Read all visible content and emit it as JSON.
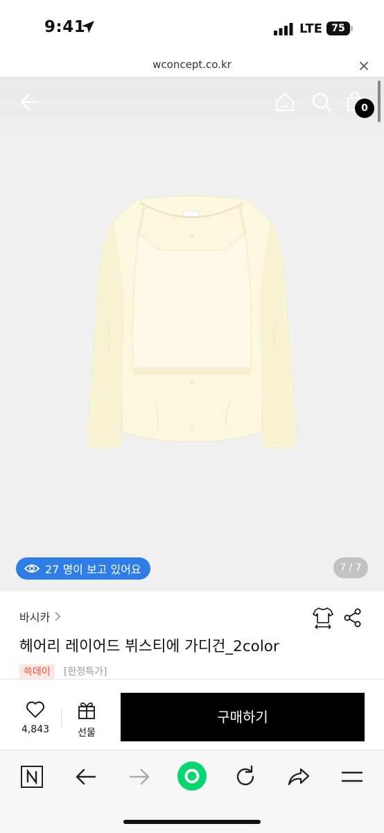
{
  "status_bar": {
    "time": "9:41",
    "network": "LTE",
    "battery": "75"
  },
  "browser": {
    "url": "wconcept.co.kr"
  },
  "hero": {
    "cart_count": "0",
    "viewers_text": "27 명이 보고 있어요",
    "page_indicator": "7 / 7"
  },
  "product": {
    "brand": "바시카",
    "title": "헤어리 레이어드 뷔스티에 가디건_2color",
    "tag": "쓱데이",
    "tag_secondary": "[한정특가]"
  },
  "buy_bar": {
    "like_count": "4,843",
    "gift_label": "선물",
    "buy_label": "구매하기"
  },
  "colors": {
    "accent_blue": "#2f7ee8",
    "tag_red": "#e9573c",
    "buy_button": "#000000"
  }
}
